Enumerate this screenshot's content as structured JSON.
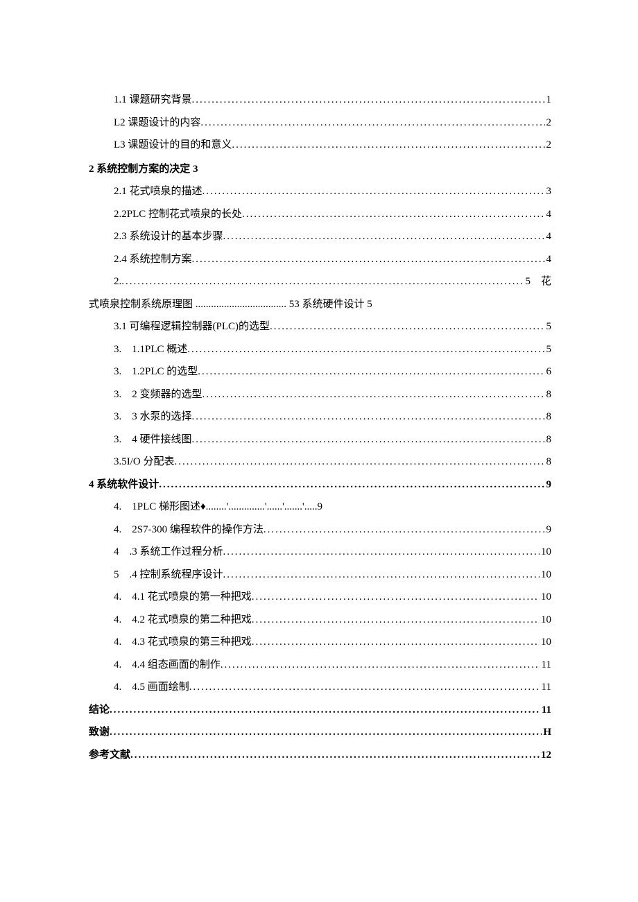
{
  "entries": [
    {
      "type": "dotted",
      "indent": true,
      "label": "1.1 课题研究背景",
      "page": "1"
    },
    {
      "type": "dotted",
      "indent": true,
      "label": "L2 课题设计的内容",
      "page": "2"
    },
    {
      "type": "dotted",
      "indent": true,
      "label": "L3 课题设计的目的和意义",
      "page": "2"
    },
    {
      "type": "heading",
      "label": "2 系统控制方案的决定 3"
    },
    {
      "type": "dotted",
      "indent": true,
      "label": "2.1 花式喷泉的描述",
      "page": "3"
    },
    {
      "type": "dotted",
      "indent": true,
      "label": "2.2PLC 控制花式喷泉的长处",
      "page": "4"
    },
    {
      "type": "dotted",
      "indent": true,
      "label": "2.3 系统设计的基本步骤",
      "page": "4"
    },
    {
      "type": "dotted",
      "indent": true,
      "label": "2.4 系统控制方案",
      "page": "4"
    },
    {
      "type": "wrap",
      "indent": true,
      "label_a": "2.",
      "label_b": "5　花",
      "wrap": "式喷泉控制系统原理图 ................................... 53 系统硬件设计 5"
    },
    {
      "type": "dotted",
      "indent": true,
      "label": "3.1 可编程逻辑控制器(PLC)的选型",
      "page": "5"
    },
    {
      "type": "dotted",
      "indent": true,
      "label": "3.　1.1PLC 概述",
      "page": "5"
    },
    {
      "type": "dotted",
      "indent": true,
      "label": "3.　1.2PLC 的选型",
      "page": "6"
    },
    {
      "type": "dotted",
      "indent": true,
      "label": "3.　2 变频器的选型",
      "page": "8"
    },
    {
      "type": "dotted",
      "indent": true,
      "label": "3.　3 水泵的选择",
      "page": "8"
    },
    {
      "type": "dotted",
      "indent": true,
      "label": "3.　4 硬件接线图",
      "page": "8"
    },
    {
      "type": "dotted",
      "indent": true,
      "label": "3.5I/O 分配表",
      "page": "8"
    },
    {
      "type": "dotted",
      "indent": false,
      "bold": true,
      "label": "4 系统软件设计",
      "page": "9"
    },
    {
      "type": "plain",
      "indent": true,
      "label": "4.　1PLC 梯形图述♦........'..............'......'.......'.....9"
    },
    {
      "type": "dotted",
      "indent": true,
      "label": "4.　2S7-300 编程软件的操作方法",
      "page": "9"
    },
    {
      "type": "dotted",
      "indent": true,
      "label": "4　.3 系统工作过程分析",
      "page": "10"
    },
    {
      "type": "dotted",
      "indent": true,
      "label": "5　.4 控制系统程序设计",
      "page": "10"
    },
    {
      "type": "dotted",
      "indent": true,
      "label": "4.　4.1 花式喷泉的第一种把戏",
      "page": "10"
    },
    {
      "type": "dotted",
      "indent": true,
      "label": "4.　4.2 花式喷泉的第二种把戏",
      "page": "10"
    },
    {
      "type": "dotted",
      "indent": true,
      "label": "4.　4.3 花式喷泉的第三种把戏",
      "page": "10"
    },
    {
      "type": "dotted",
      "indent": true,
      "label": "4.　4.4 组态画面的制作",
      "page": "11"
    },
    {
      "type": "dotted",
      "indent": true,
      "label": "4.　4.5 画面绘制",
      "page": "11"
    },
    {
      "type": "dotted",
      "indent": false,
      "bold": true,
      "label": "结论",
      "page": "11"
    },
    {
      "type": "dotted",
      "indent": false,
      "bold": true,
      "label": "致谢",
      "page": "H"
    },
    {
      "type": "dotted",
      "indent": false,
      "bold": true,
      "label": "参考文献",
      "page": "12"
    }
  ]
}
